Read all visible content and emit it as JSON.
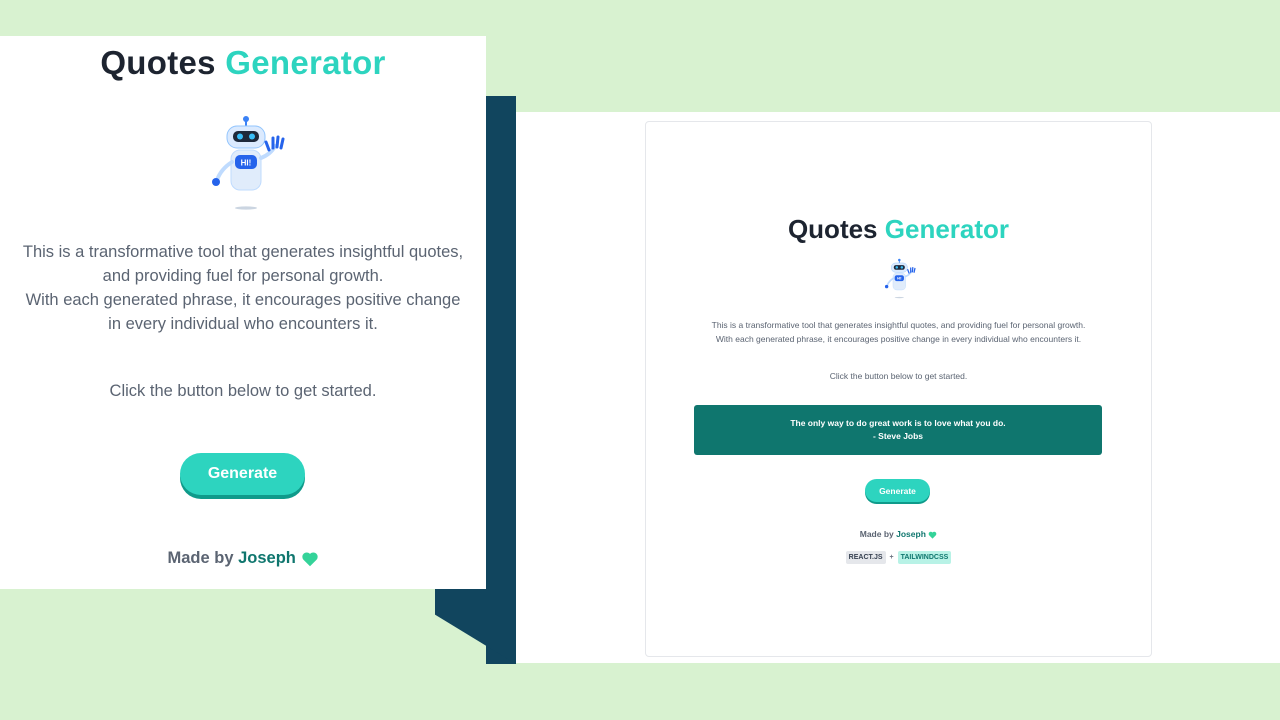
{
  "app": {
    "title_main": "Quotes",
    "title_accent": "Generator",
    "desc_line1": "This is a transformative tool that generates insightful quotes,",
    "desc_line2": "and providing fuel for personal growth.",
    "desc_line3": "With each generated phrase, it encourages positive change",
    "desc_line4": "in every individual who encounters it.",
    "desc_full_line1": "This is a transformative tool that generates insightful quotes, and providing fuel for personal growth.",
    "desc_full_line2": "With each generated phrase, it encourages positive change in every individual who encounters it.",
    "cta": "Click the button below to get started.",
    "generate_label": "Generate",
    "made_by_prefix": "Made by",
    "author_name": "Joseph",
    "robot_badge": "HI!",
    "icons": [
      "robot-icon",
      "heart-icon"
    ]
  },
  "quote": {
    "text": "The only way to do great work is to love what you do.",
    "author": "- Steve Jobs"
  },
  "tech": {
    "react": "REACT.JS",
    "plus": "+",
    "tailwind": "TAILWINDCSS"
  },
  "colors": {
    "accent": "#2dd4bf",
    "quote_bg": "#0f766e",
    "background": "#d8f2d0",
    "navy": "#11455e",
    "heart": "#34d399"
  }
}
